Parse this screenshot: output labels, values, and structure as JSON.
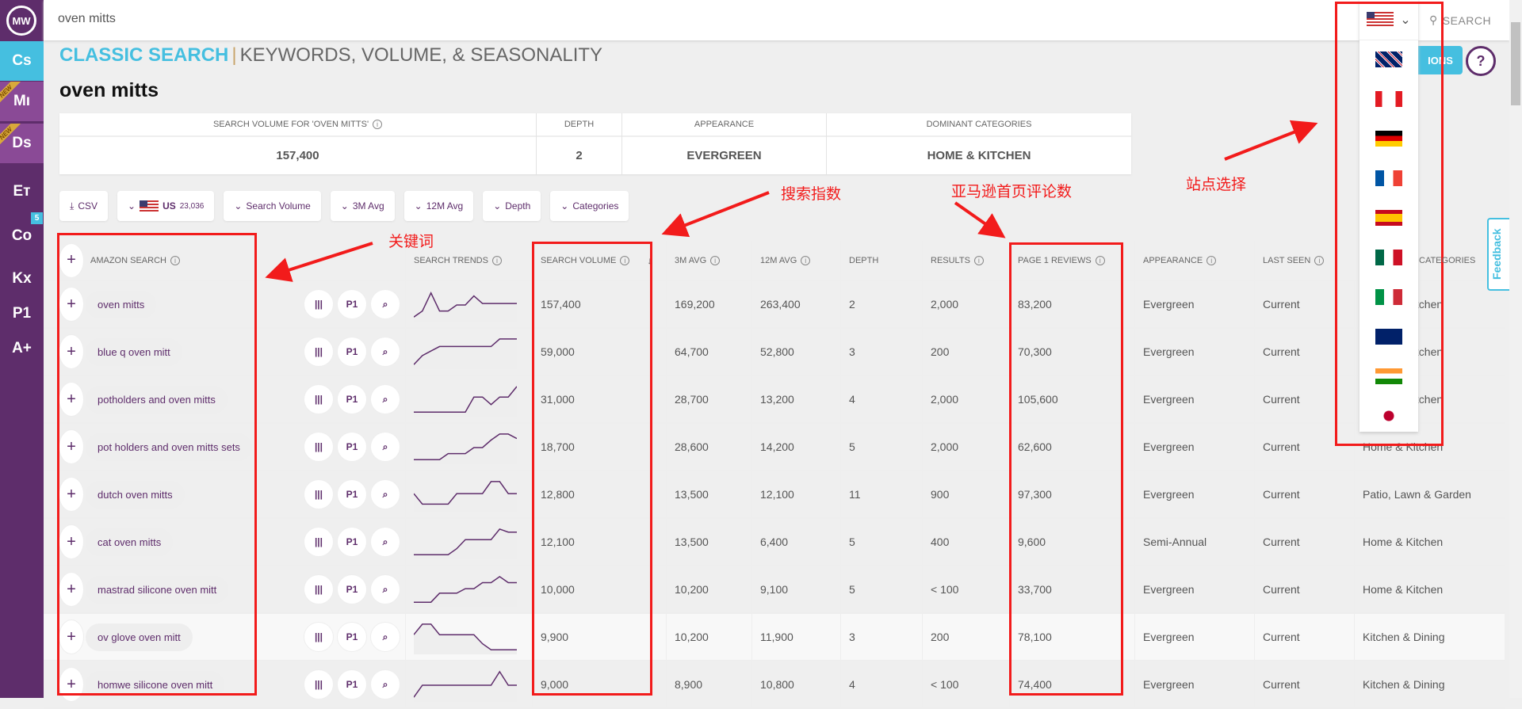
{
  "sidebar": {
    "logo": "MW",
    "items": [
      {
        "label": "Cs",
        "active": true
      },
      {
        "label": "Mı",
        "new": "NEW"
      },
      {
        "label": "Ds",
        "new": "NEW"
      },
      {
        "label": "Eт"
      },
      {
        "label": "Co",
        "badge": "5"
      },
      {
        "label": "Kx"
      },
      {
        "label": "P1"
      },
      {
        "label": "A+"
      }
    ]
  },
  "topbar": {
    "search_value": "oven mitts",
    "search_label": "SEARCH"
  },
  "header": {
    "title_primary": "CLASSIC SEARCH",
    "title_sep": "|",
    "title_secondary": "KEYWORDS, VOLUME, & SEASONALITY",
    "keyword": "oven mitts",
    "options_label": "IONS",
    "help_label": "?"
  },
  "summary": {
    "columns": [
      {
        "header": "SEARCH VOLUME FOR 'OVEN MITTS'",
        "value": "157,400"
      },
      {
        "header": "DEPTH",
        "value": "2"
      },
      {
        "header": "APPEARANCE",
        "value": "EVERGREEN"
      },
      {
        "header": "DOMINANT CATEGORIES",
        "value": "HOME & KITCHEN"
      }
    ]
  },
  "filters": {
    "csv": "CSV",
    "market": "US",
    "market_count": "23,036",
    "search_volume": "Search Volume",
    "avg3": "3M Avg",
    "avg12": "12M Avg",
    "depth": "Depth",
    "categories": "Categories"
  },
  "table": {
    "headers": {
      "amazon_search": "AMAZON SEARCH",
      "search_trends": "SEARCH TRENDS",
      "search_volume": "SEARCH VOLUME",
      "avg3": "3M AVG",
      "avg12": "12M AVG",
      "depth": "DEPTH",
      "results": "RESULTS",
      "page1_reviews": "PAGE 1 REVIEWS",
      "appearance": "APPEARANCE",
      "last_seen": "LAST SEEN",
      "categories": "CATEGORIES"
    },
    "action_labels": {
      "chart": "|||",
      "p1": "P1",
      "search": "⌕"
    },
    "rows": [
      {
        "keyword": "oven mitts",
        "trend": [
          0.1,
          0.3,
          0.9,
          0.3,
          0.3,
          0.5,
          0.5,
          0.8,
          0.55,
          0.55,
          0.55,
          0.55,
          0.55
        ],
        "volume": "157,400",
        "avg3": "169,200",
        "avg12": "263,400",
        "depth": "2",
        "results": "2,000",
        "reviews": "83,200",
        "appearance": "Evergreen",
        "last_seen": "Current",
        "category": "Home & Kitchen"
      },
      {
        "keyword": "blue q oven mitt",
        "trend": [
          0.1,
          0.4,
          0.55,
          0.7,
          0.7,
          0.7,
          0.7,
          0.7,
          0.7,
          0.7,
          0.95,
          0.95,
          0.95
        ],
        "volume": "59,000",
        "avg3": "64,700",
        "avg12": "52,800",
        "depth": "3",
        "results": "200",
        "reviews": "70,300",
        "appearance": "Evergreen",
        "last_seen": "Current",
        "category": "Home & Kitchen"
      },
      {
        "keyword": "potholders and oven mitts",
        "trend": [
          0.1,
          0.1,
          0.1,
          0.1,
          0.1,
          0.1,
          0.1,
          0.6,
          0.6,
          0.35,
          0.6,
          0.6,
          0.95
        ],
        "volume": "31,000",
        "avg3": "28,700",
        "avg12": "13,200",
        "depth": "4",
        "results": "2,000",
        "reviews": "105,600",
        "appearance": "Evergreen",
        "last_seen": "Current",
        "category": "Home & Kitchen"
      },
      {
        "keyword": "pot holders and oven mitts sets",
        "trend": [
          0.1,
          0.1,
          0.1,
          0.1,
          0.3,
          0.3,
          0.3,
          0.5,
          0.5,
          0.75,
          0.95,
          0.95,
          0.8
        ],
        "volume": "18,700",
        "avg3": "28,600",
        "avg12": "14,200",
        "depth": "5",
        "results": "2,000",
        "reviews": "62,600",
        "appearance": "Evergreen",
        "last_seen": "Current",
        "category": "Home & Kitchen"
      },
      {
        "keyword": "dutch oven mitts",
        "trend": [
          0.55,
          0.2,
          0.2,
          0.2,
          0.2,
          0.55,
          0.55,
          0.55,
          0.55,
          0.95,
          0.95,
          0.55,
          0.55
        ],
        "volume": "12,800",
        "avg3": "13,500",
        "avg12": "12,100",
        "depth": "11",
        "results": "900",
        "reviews": "97,300",
        "appearance": "Evergreen",
        "last_seen": "Current",
        "category": "Patio, Lawn & Garden"
      },
      {
        "keyword": "cat oven mitts",
        "trend": [
          0.1,
          0.1,
          0.1,
          0.1,
          0.1,
          0.3,
          0.6,
          0.6,
          0.6,
          0.6,
          0.95,
          0.85,
          0.85
        ],
        "volume": "12,100",
        "avg3": "13,500",
        "avg12": "6,400",
        "depth": "5",
        "results": "400",
        "reviews": "9,600",
        "appearance": "Semi-Annual",
        "last_seen": "Current",
        "category": "Home & Kitchen"
      },
      {
        "keyword": "mastrad silicone oven mitt",
        "trend": [
          0.1,
          0.1,
          0.1,
          0.4,
          0.4,
          0.4,
          0.55,
          0.55,
          0.75,
          0.75,
          0.95,
          0.75,
          0.75
        ],
        "volume": "10,000",
        "avg3": "10,200",
        "avg12": "9,100",
        "depth": "5",
        "results": "< 100",
        "reviews": "33,700",
        "appearance": "Evergreen",
        "last_seen": "Current",
        "category": "Home & Kitchen"
      },
      {
        "keyword": "ov glove oven mitt",
        "trend": [
          0.6,
          0.95,
          0.95,
          0.6,
          0.6,
          0.6,
          0.6,
          0.6,
          0.3,
          0.1,
          0.1,
          0.1,
          0.1
        ],
        "volume": "9,900",
        "avg3": "10,200",
        "avg12": "11,900",
        "depth": "3",
        "results": "200",
        "reviews": "78,100",
        "appearance": "Evergreen",
        "last_seen": "Current",
        "category": "Kitchen & Dining"
      },
      {
        "keyword": "homwe silicone oven mitt",
        "trend": [
          0.1,
          0.5,
          0.5,
          0.5,
          0.5,
          0.5,
          0.5,
          0.5,
          0.5,
          0.5,
          0.95,
          0.5,
          0.5
        ],
        "volume": "9,000",
        "avg3": "8,900",
        "avg12": "10,800",
        "depth": "4",
        "results": "< 100",
        "reviews": "74,400",
        "appearance": "Evergreen",
        "last_seen": "Current",
        "category": "Kitchen & Dining"
      }
    ]
  },
  "country_dropdown": {
    "selected": "US",
    "options": [
      "UK",
      "CA",
      "DE",
      "FR",
      "ES",
      "MX",
      "IT",
      "AU",
      "IN",
      "JP"
    ]
  },
  "feedback_label": "Feedback",
  "annotations": {
    "keywords": "关键词",
    "search_index": "搜索指数",
    "page1_reviews": "亚马逊首页评论数",
    "site_select": "站点选择",
    "color": "#f21b1b"
  },
  "colors": {
    "brand_purple": "#5e2d6b",
    "accent_cyan": "#45bfe0"
  }
}
